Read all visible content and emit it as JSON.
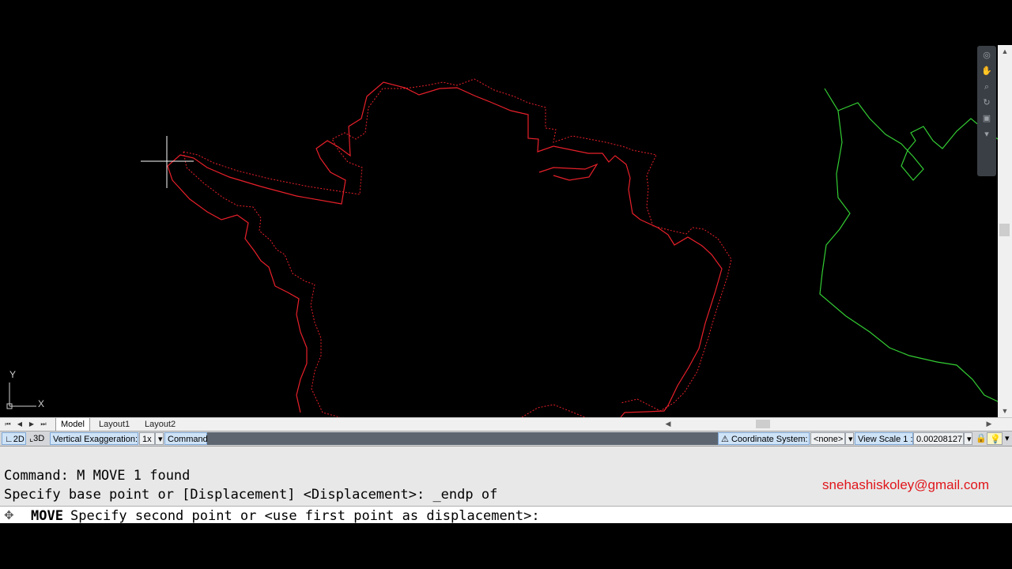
{
  "layout_tabs": [
    "Model",
    "Layout1",
    "Layout2"
  ],
  "active_tab": "Model",
  "ucs": {
    "x_label": "X",
    "y_label": "Y"
  },
  "status": {
    "mode_2d": "2D",
    "mode_3d": "3D",
    "vert_exag_label": "Vertical Exaggeration:",
    "vert_exag_value": "1x",
    "command_label": "Command",
    "coord_system_label": "Coordinate System:",
    "coord_system_value": "<none>",
    "view_scale_label": "View Scale",
    "view_scale_ratio": "1 :",
    "view_scale_value": "0.00208127"
  },
  "command": {
    "history": [
      "Command: M MOVE 1 found",
      "Specify base point or [Displacement] <Displacement>: _endp of"
    ],
    "current_name": "MOVE",
    "current_prompt": "Specify second point or <use first point as displacement>:"
  },
  "watermark": "snehashiskoley@gmail.com",
  "colors": {
    "canvas_bg": "#000000",
    "selected_outline": "#e8202a",
    "ghost_outline": "#e8202a",
    "boundary_line": "#33cc33",
    "crosshair": "#ffffff"
  },
  "icons": {
    "move": "move-arrows-icon",
    "coord": "globe-icon",
    "lock": "lock-icon",
    "bulb": "lightbulb-icon"
  }
}
